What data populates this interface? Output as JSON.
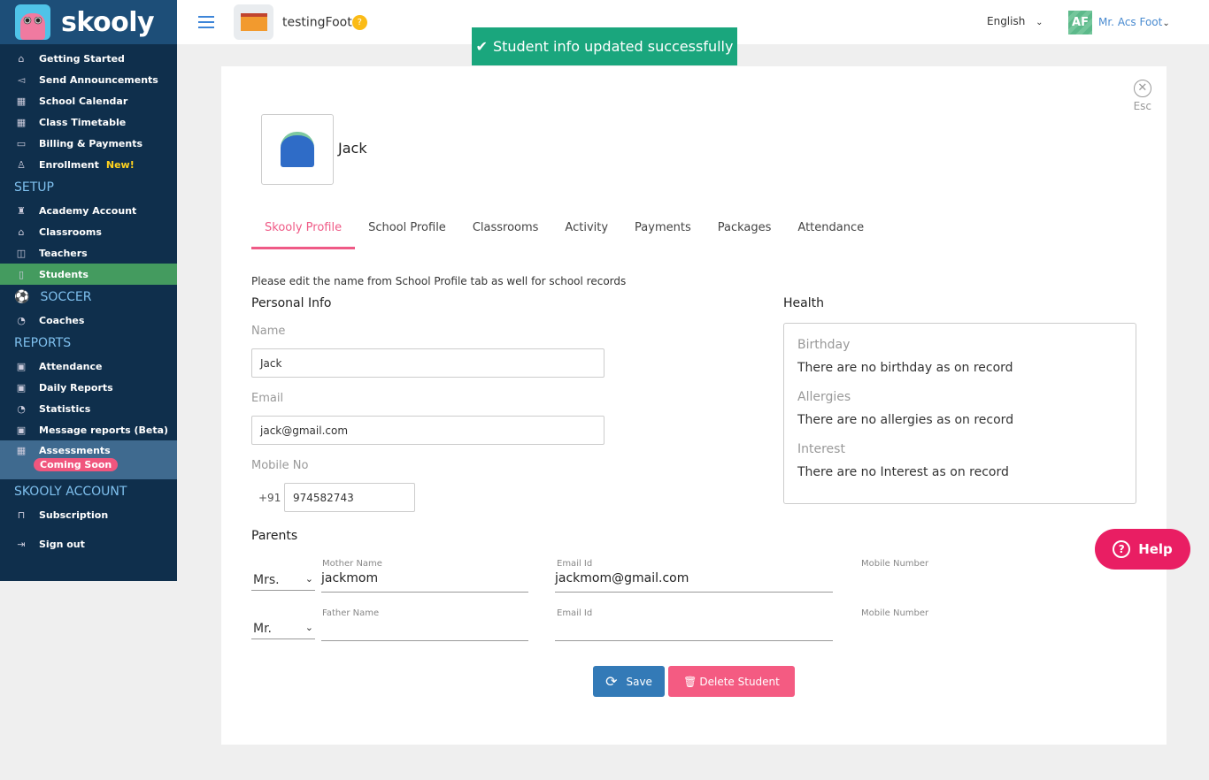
{
  "brand": {
    "name": "skooly"
  },
  "sidebar": {
    "items": [
      {
        "label": "Getting Started",
        "icon": "home-icon"
      },
      {
        "label": "Send Announcements",
        "icon": "megaphone-icon"
      },
      {
        "label": "School Calendar",
        "icon": "calendar-icon"
      },
      {
        "label": "Class Timetable",
        "icon": "calendar-icon"
      },
      {
        "label": "Billing & Payments",
        "icon": "card-icon"
      },
      {
        "label": "Enrollment",
        "icon": "user-add-icon",
        "badge": "New!"
      }
    ],
    "setup_title": "SETUP",
    "setup": [
      {
        "label": "Academy Account"
      },
      {
        "label": "Classrooms"
      },
      {
        "label": "Teachers"
      },
      {
        "label": "Students",
        "active": true
      }
    ],
    "soccer_title": "SOCCER",
    "soccer": [
      {
        "label": "Coaches"
      }
    ],
    "reports_title": "REPORTS",
    "reports": [
      {
        "label": "Attendance"
      },
      {
        "label": "Daily Reports"
      },
      {
        "label": "Statistics"
      },
      {
        "label": "Message reports (Beta)"
      },
      {
        "label": "Assessments",
        "badge": "Coming Soon"
      }
    ],
    "account_title": "SKOOLY ACCOUNT",
    "account": [
      {
        "label": "Subscription"
      },
      {
        "label": "Sign out"
      }
    ]
  },
  "topbar": {
    "school_name": "testingFoot",
    "help_badge": "?",
    "language": "English",
    "avatar_initials": "AF",
    "user_name": "Mr. Acs Foot"
  },
  "toast": {
    "message": "Student info updated successfully",
    "color": "#1aa67d"
  },
  "profile": {
    "close_label": "Esc",
    "name": "Jack",
    "tabs": [
      "Skooly Profile",
      "School Profile",
      "Classrooms",
      "Activity",
      "Payments",
      "Packages",
      "Attendance"
    ],
    "active_tab": "Skooly Profile",
    "note": "Please edit the name from School Profile tab as well for school records",
    "personal_title": "Personal Info",
    "name_label": "Name",
    "name_value": "Jack",
    "email_label": "Email",
    "email_value": "jack@gmail.com",
    "mobile_label": "Mobile No",
    "country_code": "+91",
    "mobile_value": "974582743",
    "health_title": "Health",
    "health": [
      {
        "title": "Birthday",
        "value": "There are no birthday as on record"
      },
      {
        "title": "Allergies",
        "value": "There are no allergies as on record"
      },
      {
        "title": "Interest",
        "value": "There are no Interest as on record"
      }
    ],
    "parents_title": "Parents",
    "mother": {
      "salutation": "Mrs.",
      "name_label": "Mother Name",
      "name": "jackmom",
      "email_label": "Email Id",
      "email": "jackmom@gmail.com",
      "mobile_label": "Mobile Number"
    },
    "father": {
      "salutation": "Mr.",
      "name_label": "Father Name",
      "name": "",
      "email_label": "Email Id",
      "email": "",
      "mobile_label": "Mobile Number"
    },
    "save_label": "Save",
    "delete_label": "Delete Student"
  },
  "help": {
    "label": "Help"
  }
}
